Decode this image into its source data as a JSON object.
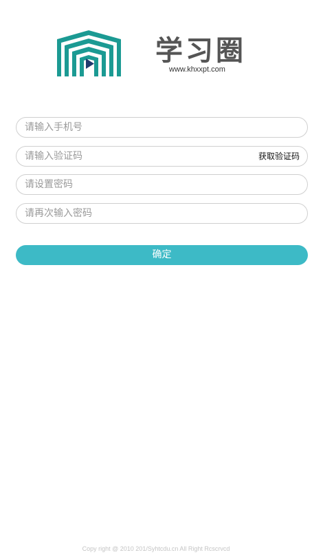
{
  "brand": {
    "logo_icon": "house-play-logo-icon",
    "name": "学习圈",
    "url": "www.khxxpt.com",
    "colors": {
      "logo_teal": "#1b9a93",
      "logo_play": "#1f3a6e",
      "title_text": "#555555"
    }
  },
  "form": {
    "phone": {
      "placeholder": "请输入手机号",
      "value": ""
    },
    "code": {
      "placeholder": "请输入验证码",
      "value": "",
      "get_code_label": "获取验证码"
    },
    "password": {
      "placeholder": "请设置密码",
      "value": ""
    },
    "confirm_password": {
      "placeholder": "请再次输入密码",
      "value": ""
    },
    "submit_label": "确定",
    "accent_color": "#3dbac6"
  },
  "footer": {
    "copyright": "Copy right @ 2010 201/Syhtcdu.cn All Right Rcscrvcd"
  }
}
